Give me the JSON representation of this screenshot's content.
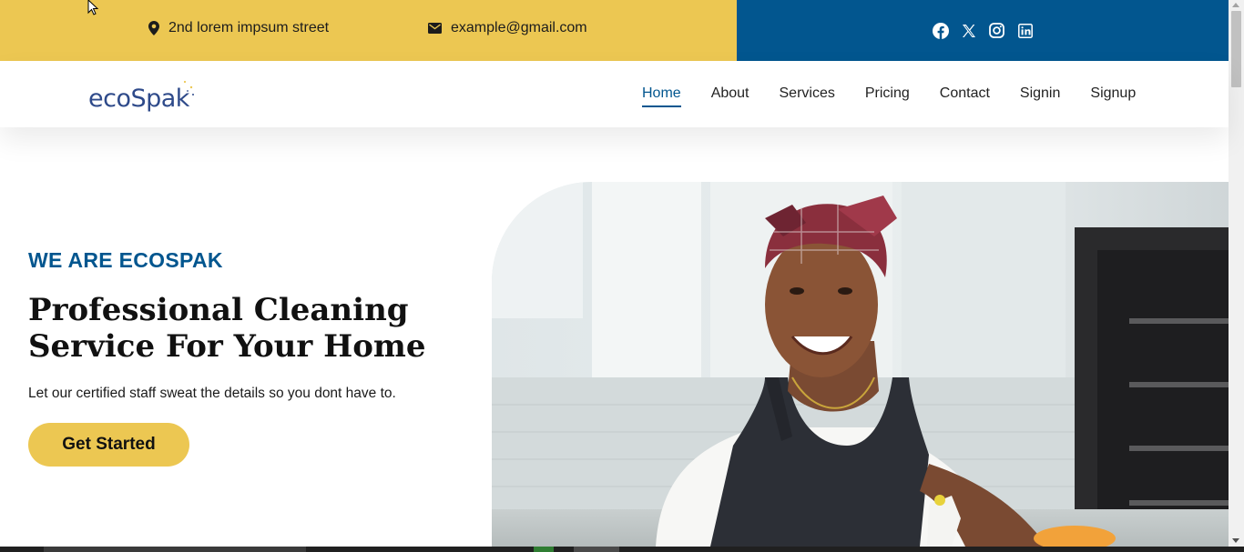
{
  "topbar": {
    "address": "2nd lorem impsum street",
    "email": "example@gmail.com",
    "left_bg": "#ecc752",
    "right_bg": "#02568f",
    "social_icons": [
      "facebook-icon",
      "x-twitter-icon",
      "instagram-icon",
      "linkedin-icon"
    ]
  },
  "navbar": {
    "logo_text": "ecoSpak",
    "links": [
      {
        "label": "Home",
        "active": true
      },
      {
        "label": "About"
      },
      {
        "label": "Services"
      },
      {
        "label": "Pricing"
      },
      {
        "label": "Contact"
      },
      {
        "label": "Signin"
      },
      {
        "label": "Signup"
      }
    ]
  },
  "hero": {
    "eyebrow": "WE ARE ECOSPAK",
    "title": "Professional Cleaning Service For Your Home",
    "subtitle": "Let our certified staff sweat the details so you dont have to.",
    "cta_label": "Get Started",
    "image_subject": "smiling woman in apron in a kitchen"
  },
  "colors": {
    "brand_blue": "#02568f",
    "brand_yellow": "#ecc752",
    "text_dark": "#111111"
  }
}
